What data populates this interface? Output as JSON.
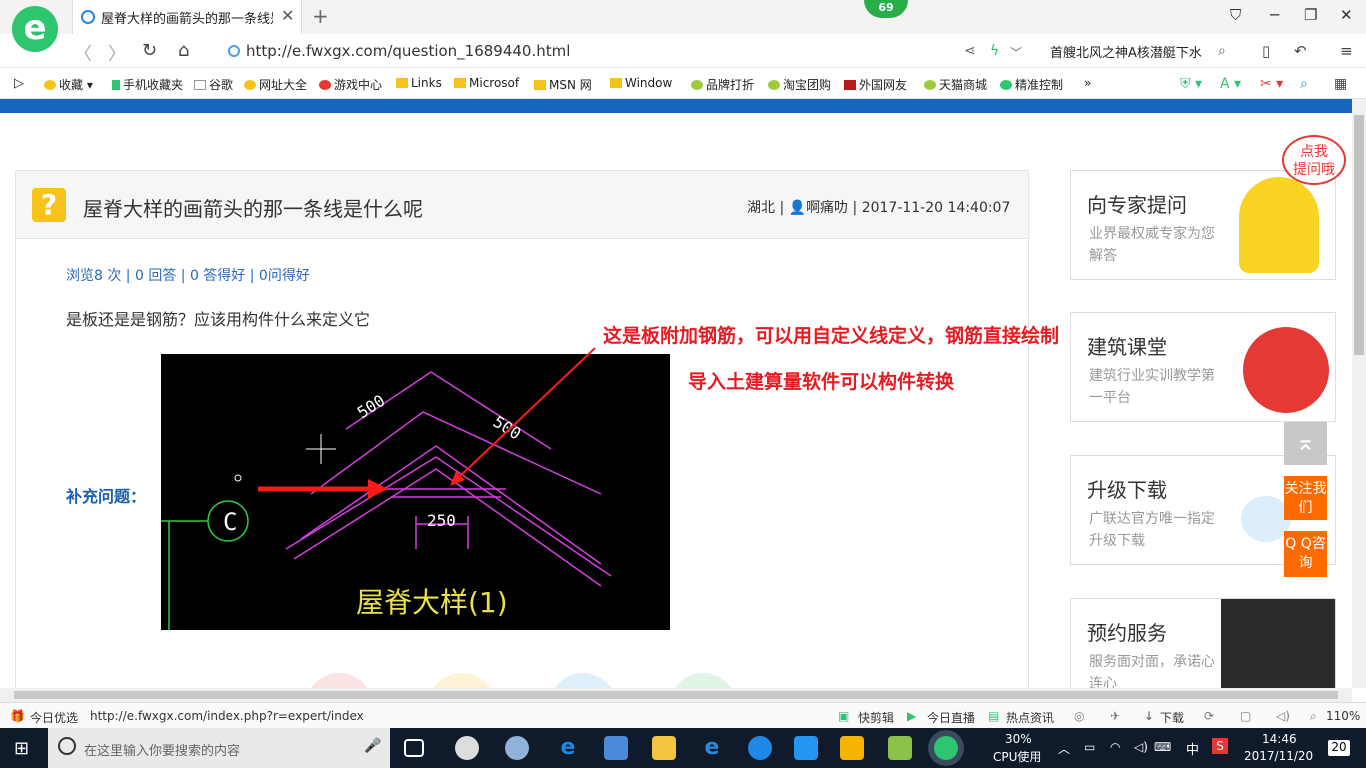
{
  "browser": {
    "tab_title": "屋脊大样的画箭头的那一条线是什",
    "badge": "69",
    "url": "http://e.fwxgx.com/question_1689440.html",
    "search_text": "首艘北风之神A核潜艇下水",
    "bookmarks": [
      "收藏",
      "手机收藏夹",
      "谷歌",
      "网址大全",
      "游戏中心",
      "Links",
      "Microsof",
      "MSN 网",
      "Window",
      "品牌打折",
      "淘宝团购",
      "外国网友",
      "天猫商城",
      "精准控制"
    ],
    "more": "»"
  },
  "question": {
    "title": "屋脊大样的画箭头的那一条线是什么呢",
    "region": "湖北",
    "user": "啊痛叻",
    "time": "2017-11-20 14:40:07",
    "stats": "浏览8 次 | 0 回答 | 0 答得好 | 0问得好",
    "body": "是板还是是钢筋？应该用构件什么来定义它",
    "supp_label": "补充问题：",
    "annotation1": "这是板附加钢筋，可以用自定义线定义，钢筋直接绘制",
    "annotation2": "导入土建算量软件可以构件转换",
    "cad": {
      "dim1": "500",
      "dim2": "500",
      "dim3": "250",
      "caption": "屋脊大样(1)"
    }
  },
  "sidebar": {
    "bubble": "点我\n提问哦",
    "cards": [
      {
        "title": "向专家提问",
        "sub": "业界最权威专家为您解答"
      },
      {
        "title": "建筑课堂",
        "sub": "建筑行业实训教学第一平台"
      },
      {
        "title": "升级下载",
        "sub": "广联达官方唯一指定升级下载"
      },
      {
        "title": "预约服务",
        "sub": "服务面对面，承诺心连心"
      }
    ],
    "float_follow": "关注我们",
    "float_qq": "Q Q咨询"
  },
  "status": {
    "left": "今日优选",
    "link": "http://e.fwxgx.com/index.php?r=expert/index",
    "items": [
      "快剪辑",
      "今日直播",
      "热点资讯",
      "下载"
    ],
    "zoom": "110%"
  },
  "taskbar": {
    "search_placeholder": "在这里输入你要搜索的内容",
    "cpu": "30%",
    "cpu_label": "CPU使用",
    "ime": "中",
    "time": "14:46",
    "date": "2017/11/20",
    "notif": "20"
  }
}
